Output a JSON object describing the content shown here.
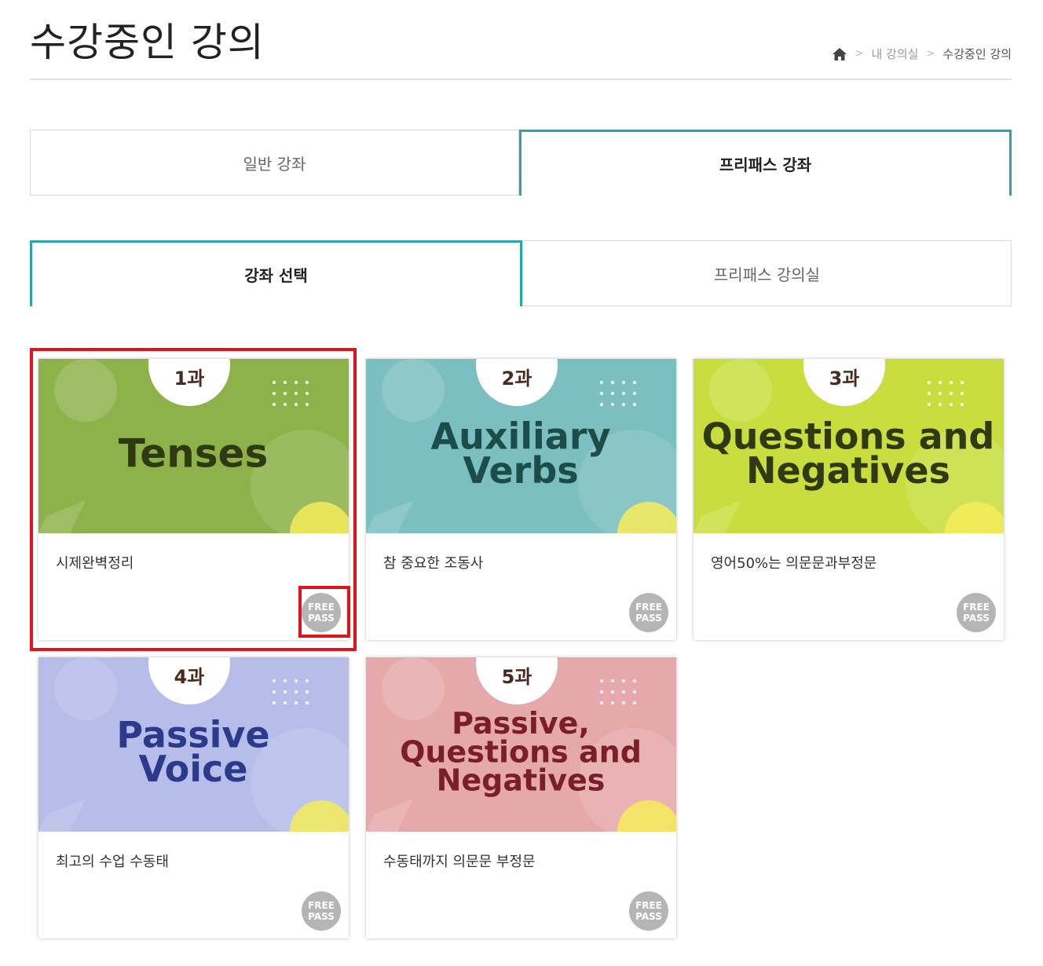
{
  "header": {
    "title": "수강중인 강의",
    "breadcrumb": {
      "level1": "내 강의실",
      "level2": "수강중인 강의"
    }
  },
  "tabs_main": [
    {
      "label": "일반 강좌",
      "active": false
    },
    {
      "label": "프리패스 강좌",
      "active": true
    }
  ],
  "tabs_sub": [
    {
      "label": "강좌 선택",
      "active": true
    },
    {
      "label": "프리패스 강의실",
      "active": false
    }
  ],
  "courses": [
    {
      "lesson": "1과",
      "thumb_lines": [
        "Tenses"
      ],
      "title": "시제완벽정리",
      "bg": "#8db24a",
      "text_color": "#2f3a12",
      "badge_top": "FREE",
      "badge_bottom": "PASS"
    },
    {
      "lesson": "2과",
      "thumb_lines": [
        "Auxiliary",
        "Verbs"
      ],
      "title": "참 중요한 조동사",
      "bg": "#7bbfc0",
      "text_color": "#1d4d48",
      "badge_top": "FREE",
      "badge_bottom": "PASS"
    },
    {
      "lesson": "3과",
      "thumb_lines": [
        "Questions and",
        "Negatives"
      ],
      "title": "영어50%는 의문문과부정문",
      "bg": "#c9de3e",
      "text_color": "#2f3a12",
      "badge_top": "FREE",
      "badge_bottom": "PASS"
    },
    {
      "lesson": "4과",
      "thumb_lines": [
        "Passive",
        "Voice"
      ],
      "title": "최고의 수업 수동태",
      "bg": "#b6bde8",
      "text_color": "#2b3a8a",
      "badge_top": "FREE",
      "badge_bottom": "PASS"
    },
    {
      "lesson": "5과",
      "thumb_lines": [
        "Passive,",
        "Questions and",
        "Negatives"
      ],
      "title": "수동태까지 의문문 부정문",
      "bg": "#e6a9ab",
      "text_color": "#7a1f2a",
      "badge_top": "FREE",
      "badge_bottom": "PASS"
    }
  ],
  "colors": {
    "accent": "#2aa6a8",
    "highlight": "#e3121b",
    "badge": "#b5b5b5"
  }
}
